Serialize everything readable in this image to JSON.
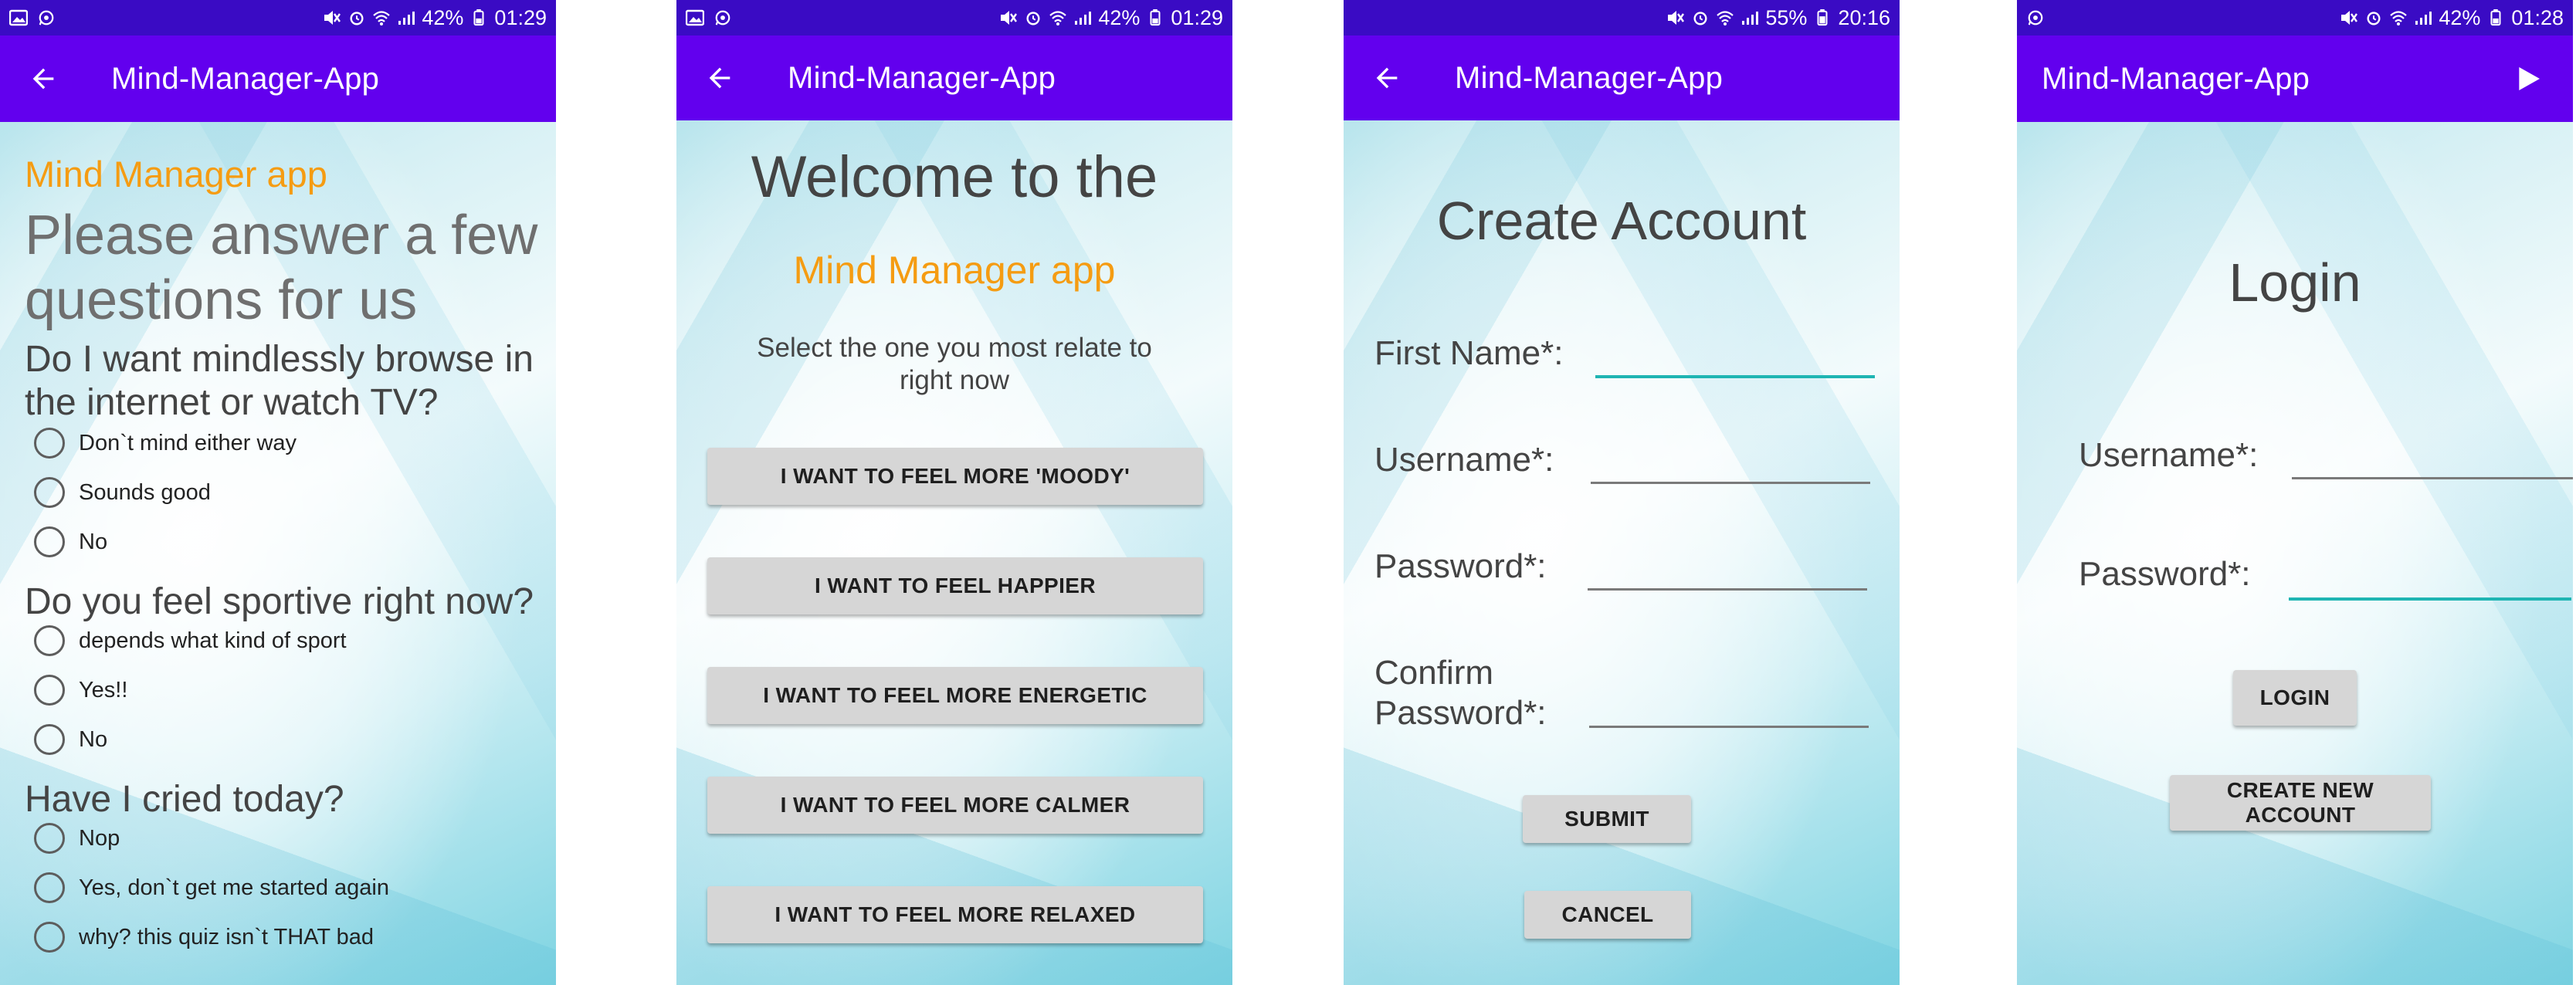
{
  "status": {
    "s1": {
      "battery": "42%",
      "time": "01:29"
    },
    "s2": {
      "battery": "42%",
      "time": "01:29"
    },
    "s3": {
      "battery": "55%",
      "time": "20:16"
    },
    "s4": {
      "battery": "42%",
      "time": "01:28"
    }
  },
  "appbar_title": "Mind-Manager-App",
  "quiz": {
    "app_name": "Mind Manager app",
    "intro": "Please answer a few questions for us",
    "questions": [
      {
        "text": "Do I want mindlessly browse in the internet or watch TV?",
        "options": [
          "Don`t mind either way",
          "Sounds good",
          "No"
        ]
      },
      {
        "text": "Do you feel sportive right now?",
        "options": [
          "depends what kind of sport",
          "Yes!!",
          "No"
        ]
      },
      {
        "text": "Have I cried today?",
        "options": [
          "Nop",
          "Yes, don`t get me started again",
          "why? this quiz isn`t THAT bad"
        ]
      }
    ]
  },
  "welcome": {
    "title": "Welcome to the",
    "app_name": "Mind Manager app",
    "subtitle": "Select the one you most relate to right now",
    "moods": [
      "I WANT TO FEEL MORE 'MOODY'",
      "I WANT TO FEEL HAPPIER",
      "I WANT TO FEEL MORE ENERGETIC",
      "I WANT TO FEEL MORE CALMER",
      "I WANT TO FEEL MORE RELAXED"
    ]
  },
  "create_account": {
    "title": "Create Account",
    "first_name_label": "First Name*:",
    "username_label": "Username*:",
    "password_label": "Password*:",
    "confirm_label_1": "Confirm",
    "confirm_label_2": "Password*:",
    "submit": "SUBMIT",
    "cancel": "CANCEL"
  },
  "login": {
    "title": "Login",
    "username_label": "Username*:",
    "password_label": "Password*:",
    "login_button": "LOGIN",
    "create_button": "CREATE NEW ACCOUNT"
  },
  "colors": {
    "statusbar": "#3a0bc4",
    "appbar": "#6200ee",
    "accent_orange": "#f59c12",
    "field_active": "#1fb5b3",
    "button_gray": "#d6d6d6"
  },
  "icons": {
    "back": "arrow-left-icon",
    "play": "play-icon",
    "gallery": "gallery-icon",
    "whatsapp": "whatsapp-icon",
    "mute": "mute-icon",
    "alarm": "alarm-icon",
    "wifi": "wifi-icon",
    "signal": "signal-icon",
    "battery": "battery-icon"
  }
}
